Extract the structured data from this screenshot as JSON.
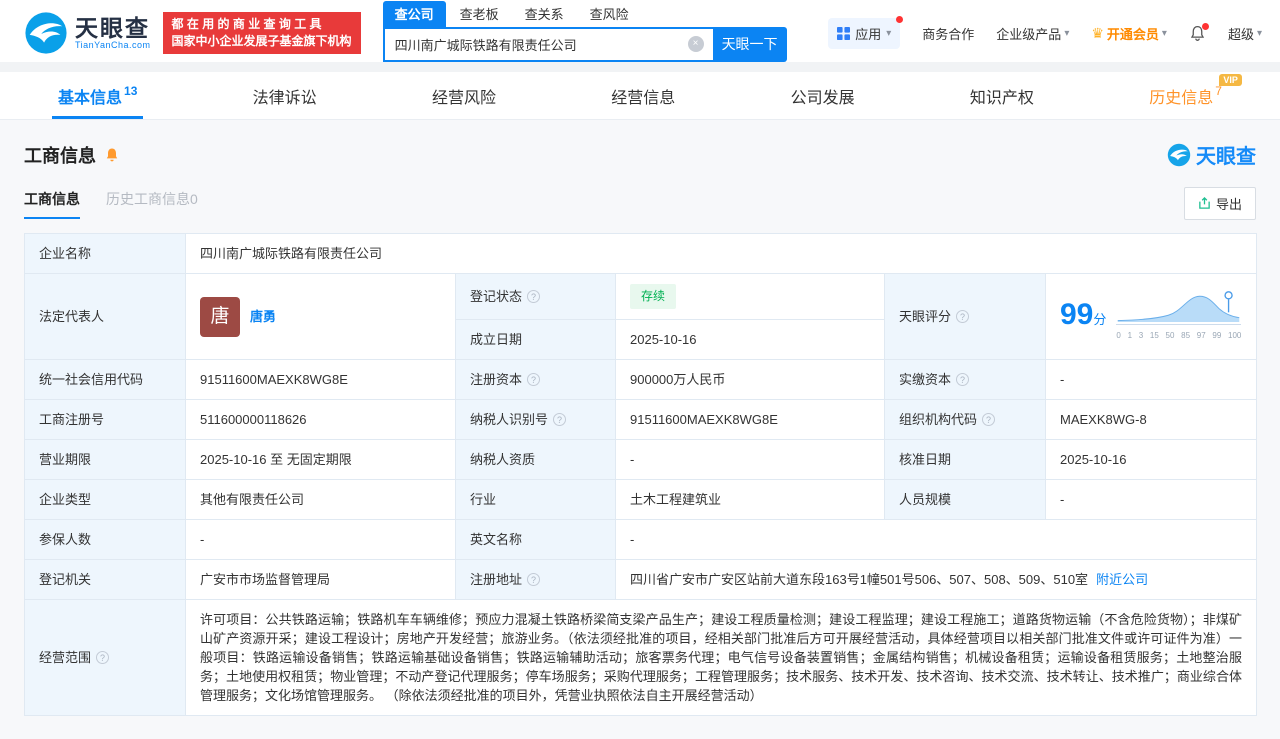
{
  "brand": {
    "logo_cn": "天眼查",
    "logo_en": "TianYanCha.com",
    "badge_line1": "都 在 用 的 商 业 查 询 工 具",
    "badge_line2": "国家中小企业发展子基金旗下机构"
  },
  "icons": {
    "caret": "▾",
    "clear": "×",
    "crown": "♛",
    "info": "?"
  },
  "colors": {
    "brand_blue": "#0b84f3",
    "badge_red": "#e83a3a",
    "vip_orange": "#ff8a00",
    "history_orange": "#ff9329",
    "status_green": "#00b152"
  },
  "search": {
    "tabs": [
      {
        "label": "查公司",
        "active": true
      },
      {
        "label": "查老板",
        "active": false
      },
      {
        "label": "查关系",
        "active": false
      },
      {
        "label": "查风险",
        "active": false
      }
    ],
    "value": "四川南广城际铁路有限责任公司",
    "button": "天眼一下"
  },
  "topnav": {
    "app": "应用",
    "cooperation": "商务合作",
    "enterprise": "企业级产品",
    "vip": "开通会员",
    "super": "超级"
  },
  "nav_tabs": [
    {
      "label": "基本信息",
      "count": "13",
      "active": true
    },
    {
      "label": "法律诉讼",
      "count": ""
    },
    {
      "label": "经营风险",
      "count": ""
    },
    {
      "label": "经营信息",
      "count": ""
    },
    {
      "label": "公司发展",
      "count": ""
    },
    {
      "label": "知识产权",
      "count": ""
    },
    {
      "label": "历史信息",
      "count": "7",
      "vip_label": "VIP"
    }
  ],
  "section": {
    "title": "工商信息",
    "subtab_active": "工商信息",
    "subtab_history": "历史工商信息0",
    "export": "导出",
    "watermark": "天眼查"
  },
  "fields": {
    "company_name": {
      "label": "企业名称",
      "value": "四川南广城际铁路有限责任公司"
    },
    "legal_rep": {
      "label": "法定代表人",
      "avatar_char": "唐",
      "name": "唐勇"
    },
    "reg_status": {
      "label": "登记状态",
      "value": "存续"
    },
    "establish_date": {
      "label": "成立日期",
      "value": "2025-10-16"
    },
    "score": {
      "label": "天眼评分",
      "value": "99",
      "unit": "分"
    },
    "credit_code": {
      "label": "统一社会信用代码",
      "value": "91511600MAEXK8WG8E"
    },
    "reg_capital": {
      "label": "注册资本",
      "value": "900000万人民币"
    },
    "paid_capital": {
      "label": "实缴资本",
      "value": "-"
    },
    "reg_number": {
      "label": "工商注册号",
      "value": "511600000118626"
    },
    "taxpayer_id": {
      "label": "纳税人识别号",
      "value": "91511600MAEXK8WG8E"
    },
    "org_code": {
      "label": "组织机构代码",
      "value": "MAEXK8WG-8"
    },
    "business_term": {
      "label": "营业期限",
      "value": "2025-10-16 至 无固定期限"
    },
    "taxpayer_qual": {
      "label": "纳税人资质",
      "value": "-"
    },
    "approval_date": {
      "label": "核准日期",
      "value": "2025-10-16"
    },
    "company_type": {
      "label": "企业类型",
      "value": "其他有限责任公司"
    },
    "industry": {
      "label": "行业",
      "value": "土木工程建筑业"
    },
    "staff_size": {
      "label": "人员规模",
      "value": "-"
    },
    "insured_count": {
      "label": "参保人数",
      "value": "-"
    },
    "english_name": {
      "label": "英文名称",
      "value": "-"
    },
    "reg_authority": {
      "label": "登记机关",
      "value": "广安市市场监督管理局"
    },
    "reg_address": {
      "label": "注册地址",
      "value": "四川省广安市广安区站前大道东段163号1幢501号506、507、508、509、510室",
      "nearby": "附近公司"
    },
    "business_scope": {
      "label": "经营范围",
      "value": "许可项目：公共铁路运输；铁路机车车辆维修；预应力混凝土铁路桥梁简支梁产品生产；建设工程质量检测；建设工程监理；建设工程施工；道路货物运输（不含危险货物）；非煤矿山矿产资源开采；建设工程设计；房地产开发经营；旅游业务。（依法须经批准的项目，经相关部门批准后方可开展经营活动，具体经营项目以相关部门批准文件或许可证件为准）一般项目：铁路运输设备销售；铁路运输基础设备销售；铁路运输辅助活动；旅客票务代理；电气信号设备装置销售；金属结构销售；机械设备租赁；运输设备租赁服务；土地整治服务；土地使用权租赁；物业管理；不动产登记代理服务；停车场服务；采购代理服务；工程管理服务；技术服务、技术开发、技术咨询、技术交流、技术转让、技术推广；商业综合体管理服务；文化场馆管理服务。 （除依法须经批准的项目外，凭营业执照依法自主开展经营活动）"
    }
  },
  "score_chart": {
    "type": "area",
    "ticks": [
      "0",
      "1",
      "3",
      "15",
      "50",
      "85",
      "97",
      "99",
      "100"
    ]
  }
}
